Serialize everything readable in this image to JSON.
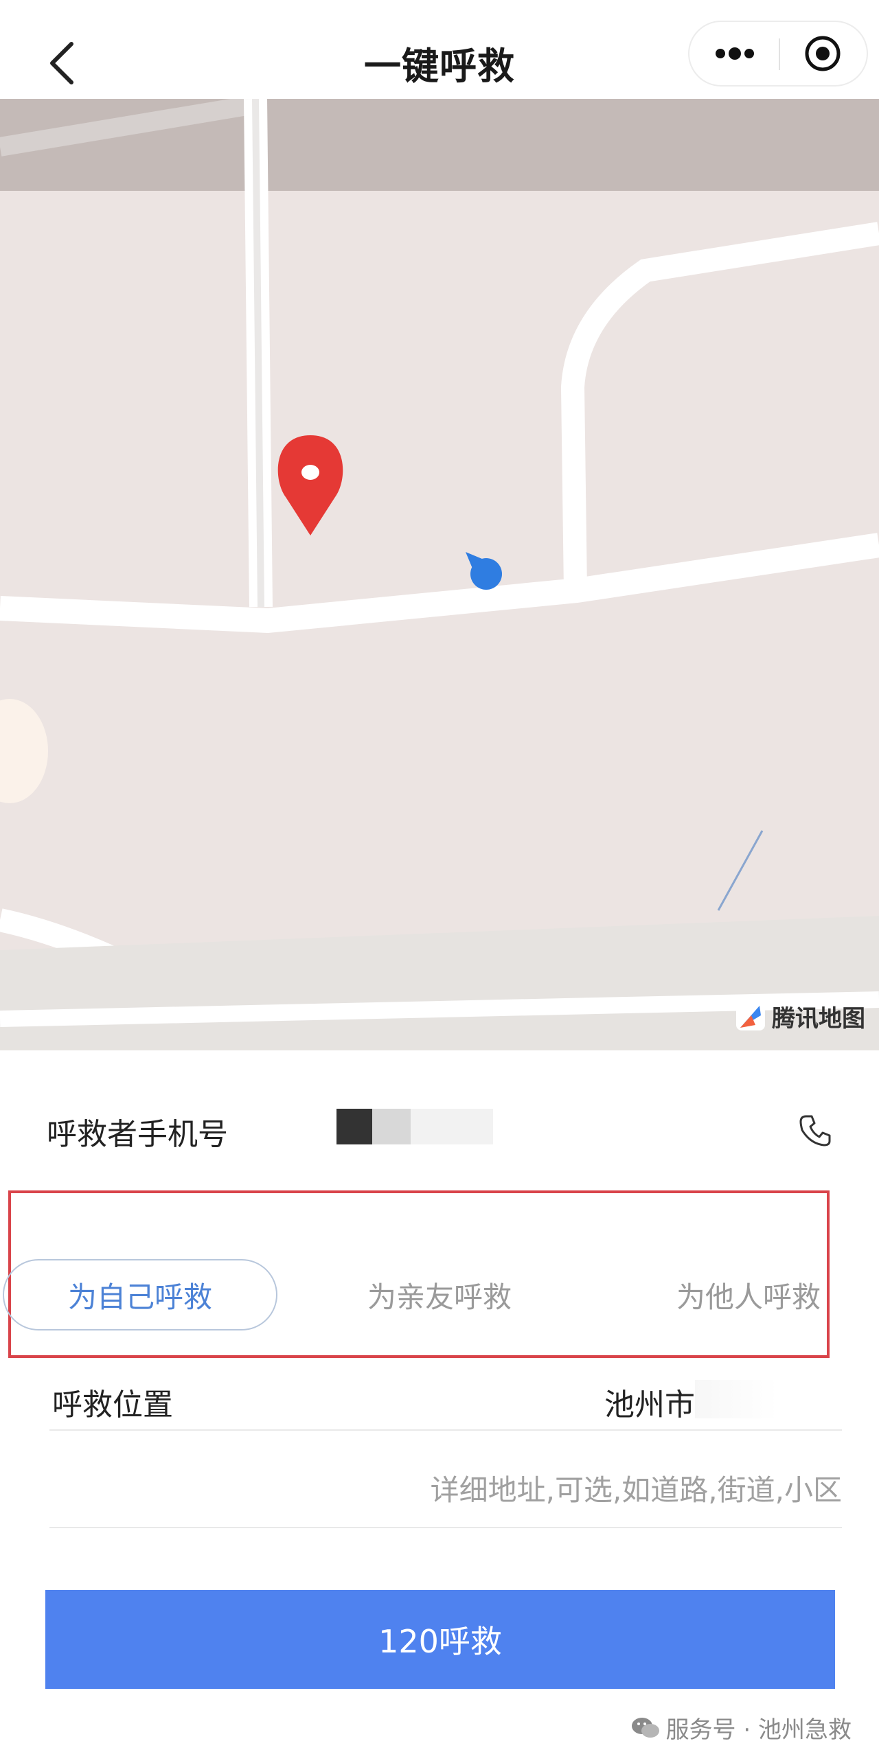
{
  "header": {
    "title": "一键呼救",
    "back_icon": "chevron-left-icon",
    "more_icon": "more-dots-icon",
    "target_icon": "target-icon"
  },
  "map": {
    "provider_label": "腾讯地图",
    "provider_icon": "tencent-map-logo",
    "pin_icon": "location-pin-icon",
    "user_location_icon": "user-location-dot-icon",
    "colors": {
      "background": "#ece4e2",
      "road": "#ffffff",
      "pin": "#e53935",
      "user_dot": "#2f7de1"
    }
  },
  "phone": {
    "label": "呼救者手机号",
    "icon": "phone-icon"
  },
  "tabs": [
    {
      "label": "为自己呼救",
      "active": true
    },
    {
      "label": "为亲友呼救",
      "active": false
    },
    {
      "label": "为他人呼救",
      "active": false
    }
  ],
  "location": {
    "label": "呼救位置",
    "value": "池州市"
  },
  "address": {
    "value": "",
    "placeholder": "详细地址,可选,如道路,街道,小区"
  },
  "call_button": {
    "label": "120呼救",
    "color": "#4f82ef"
  },
  "watermark": {
    "text": "服务号 · 池州急救",
    "icon": "wechat-icon"
  },
  "colors": {
    "accent": "#4c82d6",
    "highlight_border": "#d9444a"
  }
}
